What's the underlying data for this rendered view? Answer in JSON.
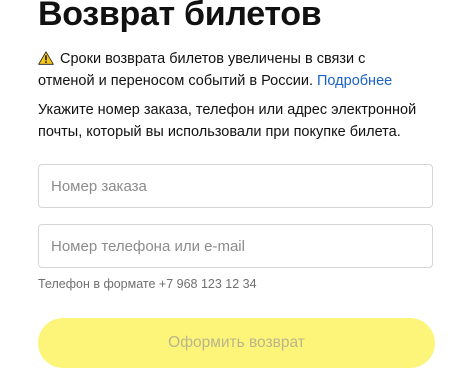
{
  "page": {
    "title": "Возврат билетов"
  },
  "notice": {
    "icon": "warning-icon",
    "line1": "Сроки возврата билетов увеличены в связи с",
    "line2_text": "отменой и переносом событий в России. ",
    "link_label": "Подробнее"
  },
  "instructions": {
    "line1": "Укажите номер заказа, телефон или адрес электронной",
    "line2": "почты, который вы использовали при покупке билета."
  },
  "form": {
    "order_number": {
      "placeholder": "Номер заказа",
      "value": ""
    },
    "contact": {
      "placeholder": "Номер телефона или e-mail",
      "value": ""
    },
    "phone_hint": "Телефон в формате +7 968 123 12 34",
    "submit_label": "Оформить возврат",
    "submit_enabled": false
  },
  "colors": {
    "link": "#1a62c5",
    "button_bg": "#fdf57a",
    "button_text": "#bab58a",
    "warning": "#f5c518"
  }
}
